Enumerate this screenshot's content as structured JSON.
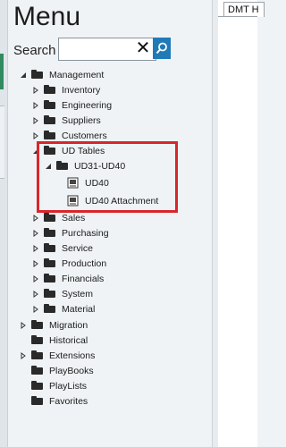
{
  "panel": {
    "title": "Menu",
    "search_label": "Search",
    "search_value": "",
    "clear_symbol": "✕"
  },
  "tree": [
    {
      "label": "Management",
      "expanded": true,
      "icon": "folder-icon"
    },
    {
      "label": "Inventory",
      "expanded": false,
      "icon": "folder-icon"
    },
    {
      "label": "Engineering",
      "expanded": false,
      "icon": "folder-icon"
    },
    {
      "label": "Suppliers",
      "expanded": false,
      "icon": "folder-icon"
    },
    {
      "label": "Customers",
      "expanded": false,
      "icon": "folder-icon"
    },
    {
      "label": "UD Tables",
      "expanded": true,
      "icon": "folder-icon"
    },
    {
      "label": "UD31-UD40",
      "expanded": true,
      "icon": "folder-icon"
    },
    {
      "label": "UD40",
      "icon": "document-icon"
    },
    {
      "label": "UD40 Attachment",
      "icon": "document-icon"
    },
    {
      "label": "Sales",
      "expanded": false,
      "icon": "folder-icon"
    },
    {
      "label": "Purchasing",
      "expanded": false,
      "icon": "folder-icon"
    },
    {
      "label": "Service",
      "expanded": false,
      "icon": "folder-icon"
    },
    {
      "label": "Production",
      "expanded": false,
      "icon": "folder-icon"
    },
    {
      "label": "Financials",
      "expanded": false,
      "icon": "folder-icon"
    },
    {
      "label": "System",
      "expanded": false,
      "icon": "folder-icon"
    },
    {
      "label": "Material",
      "expanded": false,
      "icon": "folder-icon"
    },
    {
      "label": "Migration",
      "expanded": false,
      "icon": "folder-icon"
    },
    {
      "label": "Historical",
      "icon": "folder-icon"
    },
    {
      "label": "Extensions",
      "expanded": false,
      "icon": "folder-icon"
    },
    {
      "label": "PlayBooks",
      "icon": "folder-icon"
    },
    {
      "label": "PlayLists",
      "icon": "folder-icon"
    },
    {
      "label": "Favorites",
      "icon": "folder-icon"
    }
  ],
  "right_tab": {
    "label": "DMT H"
  },
  "colors": {
    "highlight": "#d9262a",
    "search_button": "#1f7ab8",
    "background": "#f0f3f6"
  }
}
